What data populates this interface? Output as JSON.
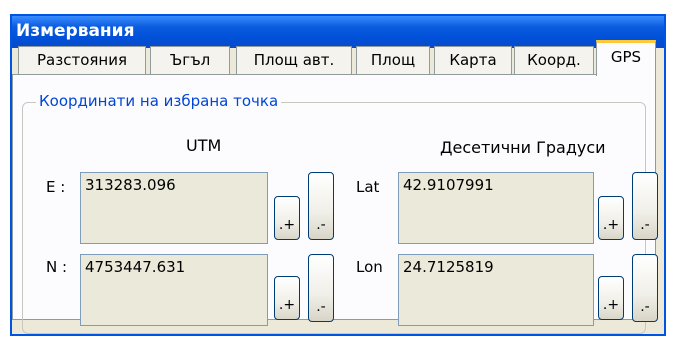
{
  "window": {
    "title": "Измервания"
  },
  "tabs": [
    {
      "label": "Разстояния"
    },
    {
      "label": "Ъгъл"
    },
    {
      "label": "Площ авт."
    },
    {
      "label": "Площ"
    },
    {
      "label": "Карта"
    },
    {
      "label": "Коорд."
    },
    {
      "label": "GPS",
      "active": true
    }
  ],
  "group": {
    "title": "Координати на избрана точка"
  },
  "utm": {
    "header": "UTM",
    "e": {
      "label": "E :",
      "value": "313283.096"
    },
    "n": {
      "label": "N :",
      "value": "4753447.631"
    }
  },
  "decimal": {
    "header": "Десетични Градуси",
    "lat": {
      "label": "Lat",
      "value": "42.9107991"
    },
    "lon": {
      "label": "Lon",
      "value": "24.7125819"
    }
  },
  "buttons": {
    "plus": ".+",
    "minus": ".-"
  }
}
